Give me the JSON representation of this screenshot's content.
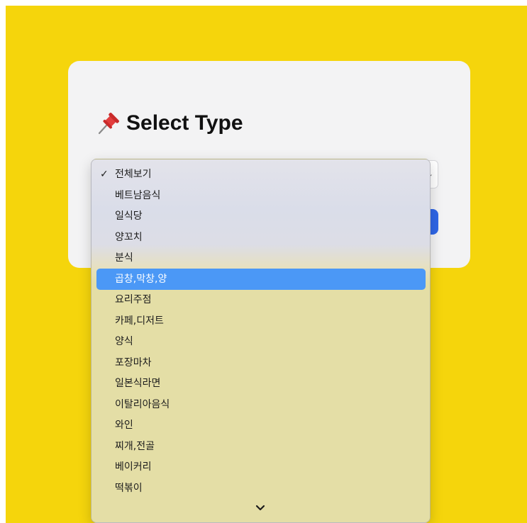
{
  "card": {
    "title": "Select Type",
    "title_icon": "pushpin-icon"
  },
  "select": {
    "selected_value": "전체보기"
  },
  "dropdown": {
    "options": [
      {
        "label": "전체보기",
        "checked": true
      },
      {
        "label": "베트남음식"
      },
      {
        "label": "일식당"
      },
      {
        "label": "양꼬치"
      },
      {
        "label": "분식"
      },
      {
        "label": "곱창,막창,양",
        "highlighted": true
      },
      {
        "label": "요리주점"
      },
      {
        "label": "카페,디저트"
      },
      {
        "label": "양식"
      },
      {
        "label": "포장마차"
      },
      {
        "label": "일본식라면"
      },
      {
        "label": "이탈리아음식"
      },
      {
        "label": "와인"
      },
      {
        "label": "찌개,전골"
      },
      {
        "label": "베이커리"
      },
      {
        "label": "떡볶이"
      }
    ],
    "more_indicator_icon": "chevron-down-icon"
  },
  "colors": {
    "background": "#f5d50c",
    "card": "#f3f3f4",
    "button": "#2f66e6",
    "highlight": "#4b98f6"
  }
}
